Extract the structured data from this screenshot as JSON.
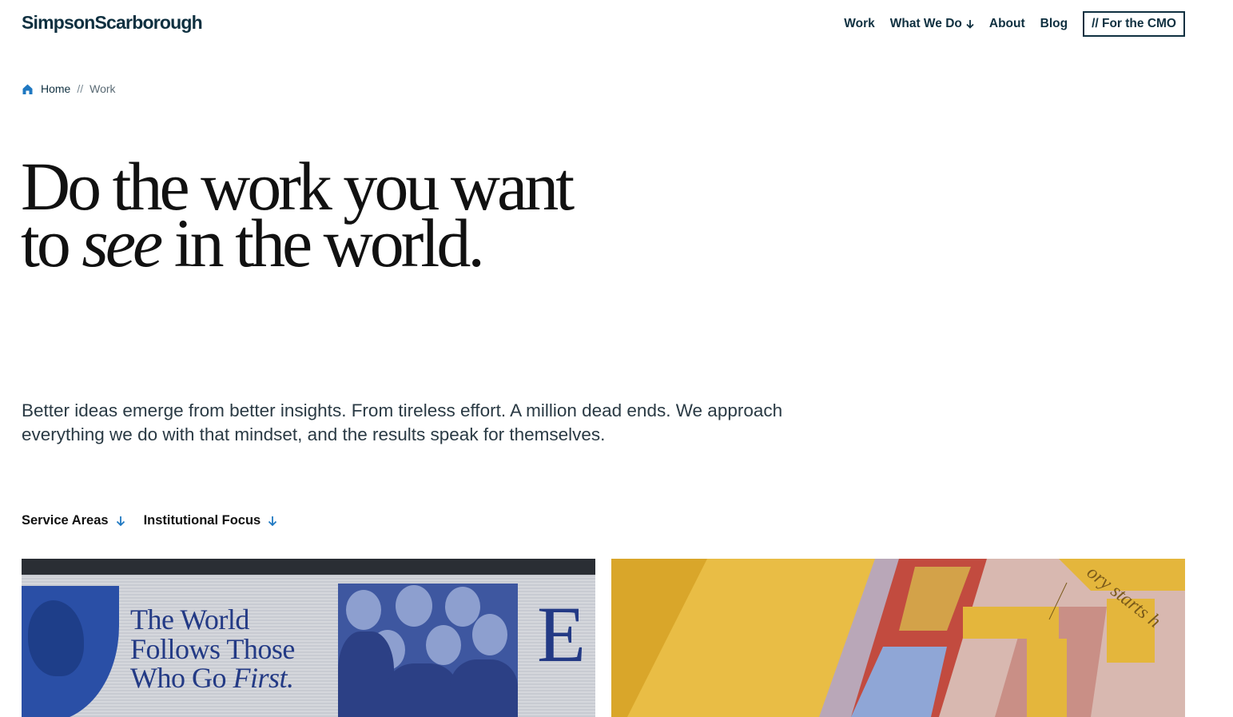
{
  "header": {
    "logo": "SimpsonScarborough",
    "nav": [
      {
        "label": "Work"
      },
      {
        "label": "What We Do"
      },
      {
        "label": "About"
      },
      {
        "label": "Blog"
      }
    ],
    "cta_label": "// For the CMO"
  },
  "breadcrumb": {
    "home": "Home",
    "separator": "//",
    "current": "Work"
  },
  "hero": {
    "line1": "Do the work you want",
    "line2_start": "to ",
    "line2_emphasis": "see",
    "line2_end": " in the world."
  },
  "lede": "Better ideas emerge from better insights. From tireless effort. A million dead ends. We approach everything we do with that mindset, and the results speak for themselves.",
  "filters": [
    {
      "label": "Service Areas"
    },
    {
      "label": "Institutional Focus"
    }
  ],
  "cards": {
    "left": {
      "billboard_line1": "The World",
      "billboard_line2": "Follows Those",
      "billboard_line3_start": "Who Go ",
      "billboard_line3_emphasis": "First.",
      "billboard_letter": "E"
    },
    "right": {
      "partial_text": "ory starts h"
    }
  },
  "colors": {
    "brand_navy": "#0f3040",
    "accent_blue": "#1f78c1",
    "billboard_blue": "#233a85",
    "yellow": "#e3b236"
  }
}
